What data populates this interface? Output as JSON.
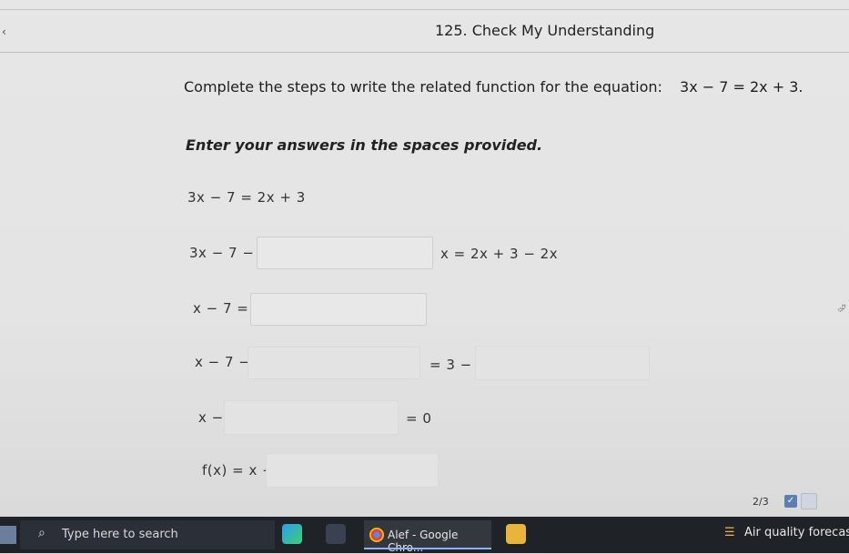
{
  "window": {
    "back_glyph": "‹",
    "title": "125. Check My Understanding"
  },
  "question": {
    "prompt": "Complete the steps to write the related function for the equation:",
    "equation": "3x − 7 = 2x + 3.",
    "instruction": "Enter your answers in the spaces provided."
  },
  "steps": {
    "line1": "3x − 7 = 2x + 3",
    "line2_left": "3x − 7 −",
    "line2_right": "x = 2x + 3 − 2x",
    "line3_left": "x − 7 =",
    "line4_left": "x − 7 −",
    "line4_right": "= 3 −",
    "line5_left": "x −",
    "line5_right": "= 0",
    "line6_left": "f(x) = x −"
  },
  "progress": {
    "text": "2/3"
  },
  "taskbar": {
    "search_placeholder": "Type here to search",
    "chrome_label": "Alef - Google Chro...",
    "weather_text": "Air quality forecast"
  },
  "colors": {
    "taskbar_bg": "#1f2328",
    "accent": "#5b7fb0"
  }
}
